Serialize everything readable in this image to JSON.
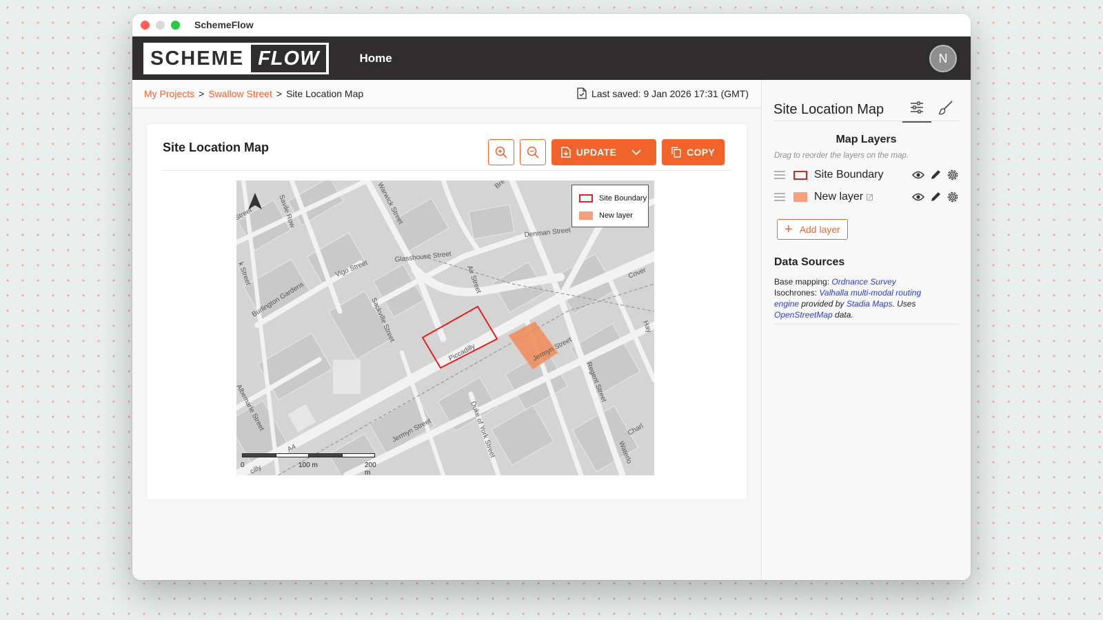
{
  "window": {
    "title": "SchemeFlow"
  },
  "brand": {
    "logo_left": "SCHEME",
    "logo_right": "FLOW"
  },
  "nav": {
    "home": "Home"
  },
  "user": {
    "avatar_initial": "N"
  },
  "breadcrumb": {
    "items": [
      "My Projects",
      "Swallow Street"
    ],
    "separator": ">",
    "current": "Site Location Map"
  },
  "status": {
    "last_saved": "Last saved: 9 Jan 2026 17:31 (GMT)"
  },
  "card": {
    "title": "Site Location Map",
    "update_label": "UPDATE",
    "copy_label": "COPY"
  },
  "map": {
    "legend": [
      "Site Boundary",
      "New layer"
    ],
    "scale_labels": [
      "0",
      "100 m",
      "200 m"
    ],
    "street_labels": {
      "savile_row": "Savile Row",
      "warwick_street": "Warwick Street",
      "bre": "Bre",
      "denman_street": "Denman Street",
      "glasshouse_street": "Glasshouse Street",
      "vigo_street": "Vigo Street",
      "air_street": "Air Street",
      "burlington_gardens": "Burlington Gardens",
      "sackville_street": "Sackville Street",
      "piccadilly": "Piccadilly",
      "jermyn_street_1": "Jermyn Street",
      "jermyn_street_2": "Jermyn Street",
      "albemarle_street": "Albemarle Street",
      "duke_of_york_street": "Duke of York Street",
      "regent_street": "Regent Street",
      "waterloo": "Waterlo",
      "charl": "Charl",
      "cover": "Cover",
      "hay": "Hay",
      "a4": "A4",
      "street_w": "Street",
      "k_street": "k Street",
      "tilly": "cilly"
    },
    "colors": {
      "site_boundary": "#e02020",
      "new_layer": "#f5a07a"
    }
  },
  "sidebar": {
    "title": "Site Location Map",
    "map_layers_title": "Map Layers",
    "hint": "Drag to reorder the layers on the map.",
    "layers": [
      {
        "name": "Site Boundary"
      },
      {
        "name": "New layer"
      }
    ],
    "add_layer": "Add layer",
    "data_sources_title": "Data Sources",
    "ds": {
      "base_prefix": "Base mapping: ",
      "base_link": "Ordnance Survey",
      "iso_prefix": "Isochrones: ",
      "iso_link": "Valhalla multi-modal routing engine",
      "provided_by": " provided by ",
      "stadia_link": "Stadia Maps",
      "uses": ". Uses ",
      "osm_link": "OpenStreetMap",
      "data_suffix": " data."
    }
  },
  "colors": {
    "accent": "#f0642b",
    "topbar": "#2f2d2e",
    "link": "#2a3cd8"
  },
  "icons": [
    "zoom-in-icon",
    "zoom-out-icon",
    "document-icon",
    "copy-icon",
    "chevron-down-icon",
    "sliders-icon",
    "brush-icon",
    "drag-handle-icon",
    "eye-icon",
    "pencil-icon",
    "gear-icon",
    "north-arrow-icon",
    "edit-small-icon"
  ]
}
